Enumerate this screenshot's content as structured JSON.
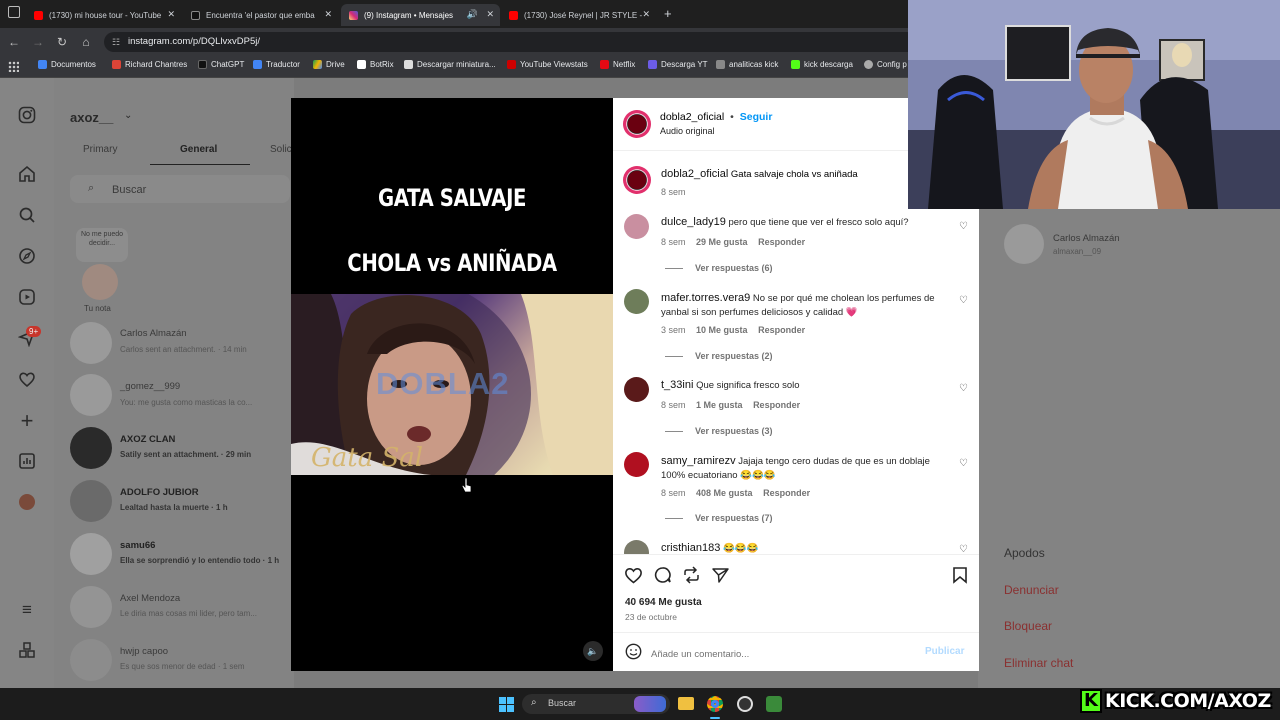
{
  "browser": {
    "tabs": [
      {
        "label": "(1730) mi house tour - YouTube",
        "color": "#ff0000"
      },
      {
        "label": "Encuentra 'el pastor que emba",
        "color": "#111111"
      },
      {
        "label": "(9) Instagram • Mensajes",
        "color": "#e1306c"
      },
      {
        "label": "(1730) José Reynel | JR STYLE -",
        "color": "#ff0000"
      }
    ],
    "url": "instagram.com/p/DQLlvxvDP5j/",
    "bookmarks": [
      {
        "label": "Documentos",
        "color": "#4285f4"
      },
      {
        "label": "Richard Chantres",
        "color": "#db4437"
      },
      {
        "label": "ChatGPT",
        "color": "#111111"
      },
      {
        "label": "Traductor",
        "color": "#4285f4"
      },
      {
        "label": "Drive",
        "color": "#0f9d58"
      },
      {
        "label": "BotRix",
        "color": "#ffffff"
      },
      {
        "label": "Descargar miniatura...",
        "color": "#dddddd"
      },
      {
        "label": "YouTube Viewstats",
        "color": "#cc0000"
      },
      {
        "label": "Netflix",
        "color": "#e50914"
      },
      {
        "label": "Descarga YT",
        "color": "#6c5ce7"
      },
      {
        "label": "analiticas kick",
        "color": "#888888"
      },
      {
        "label": "kick descarga",
        "color": "#53fc18"
      },
      {
        "label": "Config p",
        "color": "#aaaaaa"
      }
    ]
  },
  "dm": {
    "username": "axoz__",
    "tabs": [
      "Primary",
      "General",
      "Solic"
    ],
    "search_placeholder": "Buscar",
    "note": "No me puedo decidir...",
    "your_note": "Tu nota",
    "conversations": [
      {
        "name": "Carlos Almazán",
        "preview": "Carlos sent an attachment. · 14 min"
      },
      {
        "name": "_gomez__999",
        "preview": "You: me gusta como masticas la co..."
      },
      {
        "name": "AXOZ CLAN",
        "preview": "Satily sent an attachment. · 29 min"
      },
      {
        "name": "ADOLFO JUBIOR",
        "preview": "Lealtad hasta la muerte · 1 h"
      },
      {
        "name": "samu66",
        "preview": "Ella se sorprendió y lo entendio todo · 1 h"
      },
      {
        "name": "Axel Mendoza",
        "preview": "Le diria mas cosas mi lider, pero tam..."
      },
      {
        "name": "hwjp capoo",
        "preview": "Es que sos menor de edad · 1 sem"
      }
    ],
    "badge": "9+"
  },
  "right_panel": {
    "contact_name": "Carlos Almazán",
    "contact_handle": "almaxan__09",
    "options": [
      "Apodos",
      "Denunciar",
      "Bloquear",
      "Eliminar chat"
    ]
  },
  "video": {
    "title_line1": "GATA SALVAJE",
    "title_line2": "CHOLA vs ANIÑADA",
    "watermark": "DOBLA2"
  },
  "post": {
    "author": "dobla2_oficial",
    "follow": "Seguir",
    "audio": "Audio original",
    "caption_user": "dobla2_oficial",
    "caption_text": "Gata salvaje chola vs aniñada",
    "caption_time": "8 sem",
    "likes": "40 694 Me gusta",
    "date": "23 de octubre",
    "comment_placeholder": "Añade un comentario...",
    "publish": "Publicar"
  },
  "comments": [
    {
      "user": "dulce_lady19",
      "text": "pero que tiene que ver el fresco solo aquí?",
      "time": "8 sem",
      "likes": "29 Me gusta",
      "reply": "Responder",
      "replies": "Ver respuestas (6)",
      "avatar_color": "#c98fa0"
    },
    {
      "user": "mafer.torres.vera9",
      "text": "No se por qué me cholean los perfumes de yanbal si son perfumes deliciosos y calidad 💗",
      "time": "3 sem",
      "likes": "10 Me gusta",
      "reply": "Responder",
      "replies": "Ver respuestas (2)",
      "avatar_color": "#6e7d5a"
    },
    {
      "user": "t_33ini",
      "text": "Que significa fresco solo",
      "time": "8 sem",
      "likes": "1 Me gusta",
      "reply": "Responder",
      "replies": "Ver respuestas (3)",
      "avatar_color": "#5a1a1a"
    },
    {
      "user": "samy_ramirezv",
      "text": "Jajaja tengo cero dudas de que es un doblaje 100% ecuatoriano 😂😂😂",
      "time": "8 sem",
      "likes": "408 Me gusta",
      "reply": "Responder",
      "replies": "Ver respuestas (7)",
      "avatar_color": "#b01020"
    },
    {
      "user": "cristhian183",
      "text": "😂😂😂",
      "time": "",
      "likes": "",
      "reply": "",
      "replies": "",
      "avatar_color": "#7a7a6a"
    }
  ],
  "taskbar": {
    "search": "Buscar"
  },
  "overlay": {
    "kick": "KICK.COM/AXOZ"
  }
}
